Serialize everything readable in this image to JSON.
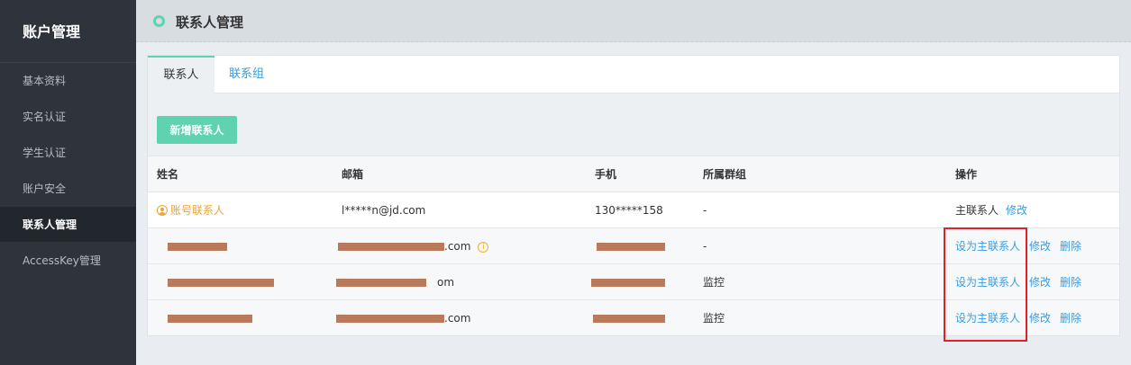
{
  "sidebar": {
    "title": "账户管理",
    "items": [
      {
        "label": "基本资料"
      },
      {
        "label": "实名认证"
      },
      {
        "label": "学生认证"
      },
      {
        "label": "账户安全"
      },
      {
        "label": "联系人管理"
      },
      {
        "label": "AccessKey管理"
      }
    ],
    "active_index": 4
  },
  "header": {
    "title": "联系人管理"
  },
  "tabs": [
    {
      "label": "联系人",
      "active": true
    },
    {
      "label": "联系组",
      "active": false
    }
  ],
  "add_button": "新增联系人",
  "table": {
    "columns": [
      "姓名",
      "邮箱",
      "手机",
      "所属群组",
      "操作"
    ],
    "rows": [
      {
        "name": "账号联系人",
        "email": "l*****n@jd.com",
        "phone": "130*****158",
        "group": "-",
        "ops": [
          "主联系人",
          "修改"
        ]
      },
      {
        "name": "",
        "email": ".com",
        "phone": "",
        "group": "-",
        "ops": [
          "设为主联系人",
          "修改",
          "删除"
        ]
      },
      {
        "name": "",
        "email": "om",
        "phone": "",
        "group": "监控",
        "ops": [
          "设为主联系人",
          "修改",
          "删除"
        ]
      },
      {
        "name": "",
        "email": ".com",
        "phone": "",
        "group": "监控",
        "ops": [
          "设为主联系人",
          "修改",
          "删除"
        ]
      }
    ]
  },
  "colors": {
    "sidebar_bg": "#2f333b",
    "accent": "#5fd2b0",
    "link": "#3a9be0",
    "main_contact": "#f0a030",
    "highlight": "#e0202a"
  }
}
